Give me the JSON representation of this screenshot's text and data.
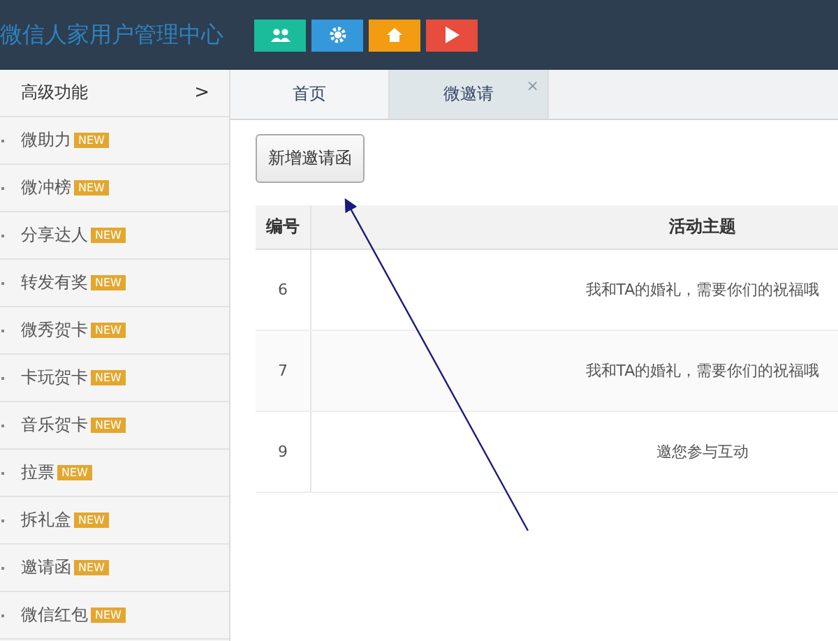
{
  "header": {
    "title": "微信人家用户管理中心",
    "buttons": [
      {
        "kind": "users",
        "color": "#1abc9c"
      },
      {
        "kind": "gear",
        "color": "#3498db"
      },
      {
        "kind": "home",
        "color": "#f39c12"
      },
      {
        "kind": "play",
        "color": "#e74c3c"
      }
    ]
  },
  "sidebar": {
    "heading": {
      "label": "高级功能",
      "chevron": ">"
    },
    "items": [
      {
        "label": "微助力",
        "badge": "NEW"
      },
      {
        "label": "微冲榜",
        "badge": "NEW"
      },
      {
        "label": "分享达人",
        "badge": "NEW"
      },
      {
        "label": "转发有奖",
        "badge": "NEW"
      },
      {
        "label": "微秀贺卡",
        "badge": "NEW"
      },
      {
        "label": "卡玩贺卡",
        "badge": "NEW"
      },
      {
        "label": "音乐贺卡",
        "badge": "NEW"
      },
      {
        "label": "拉票",
        "badge": "NEW"
      },
      {
        "label": "拆礼盒",
        "badge": "NEW"
      },
      {
        "label": "邀请函",
        "badge": "NEW"
      },
      {
        "label": "微信红包",
        "badge": "NEW"
      }
    ]
  },
  "tabs": [
    {
      "label": "首页",
      "selected": false
    },
    {
      "label": "微邀请",
      "selected": true,
      "close": "×"
    }
  ],
  "add_button": "新增邀请函",
  "table": {
    "columns": [
      "编号",
      "活动主题"
    ],
    "rows": [
      [
        "6",
        "我和TA的婚礼，需要你们的祝福哦"
      ],
      [
        "7",
        "我和TA的婚礼，需要你们的祝福哦"
      ],
      [
        "9",
        "邀您参与互动"
      ]
    ]
  }
}
